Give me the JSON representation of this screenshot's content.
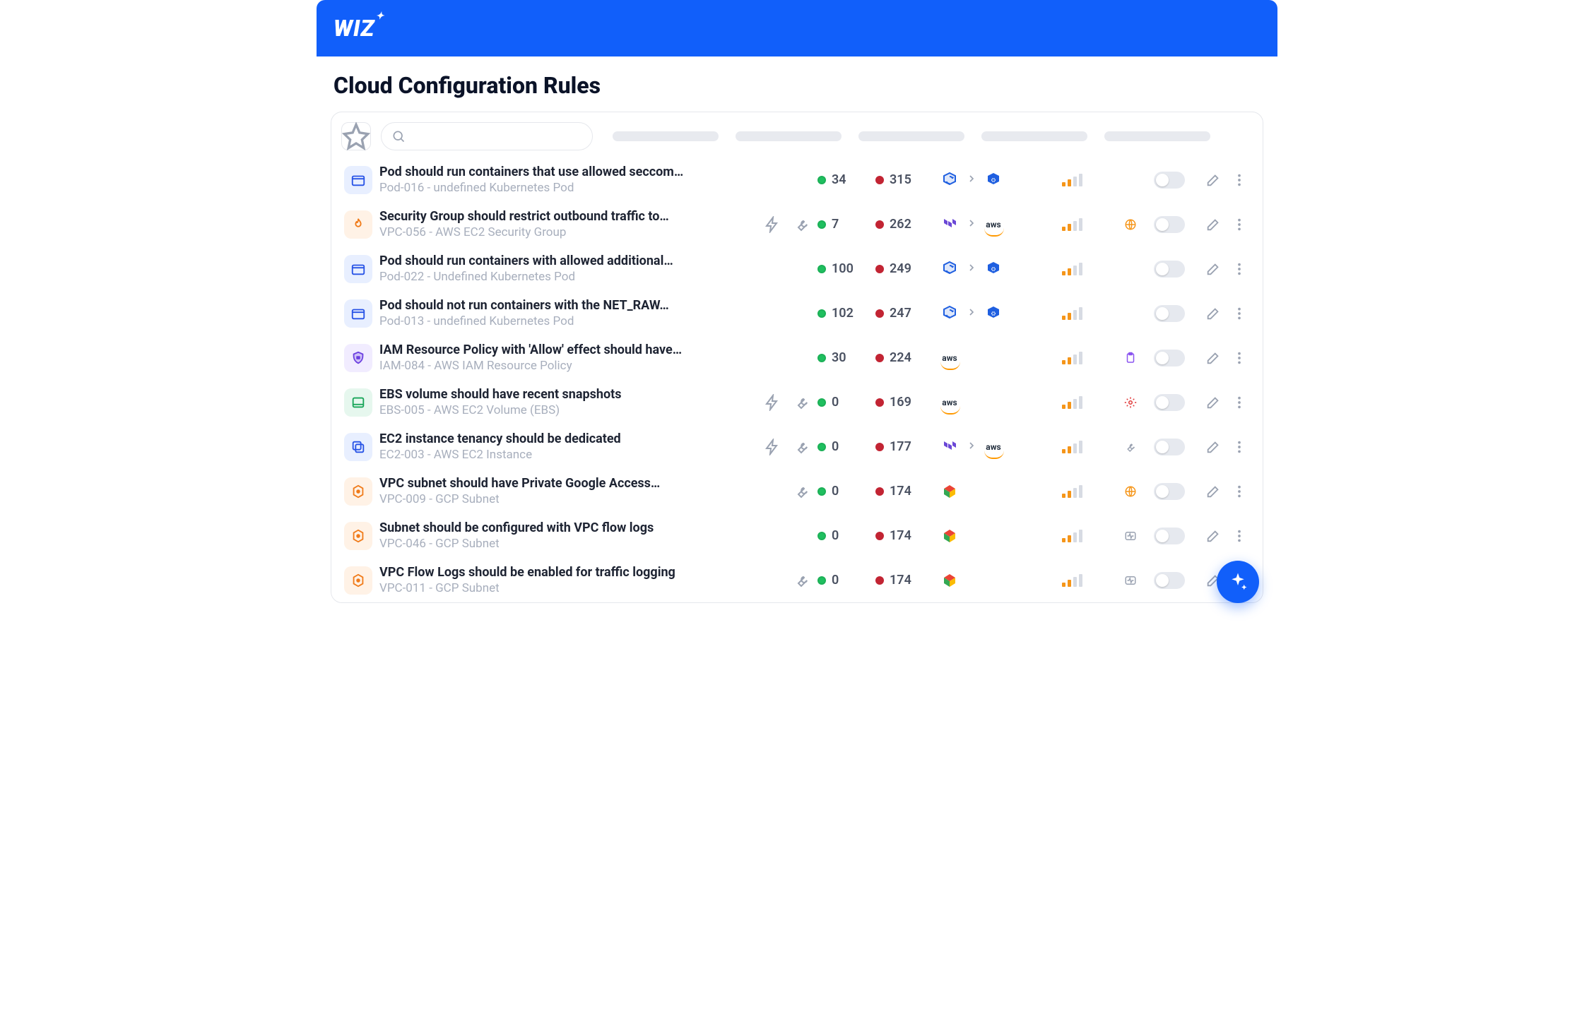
{
  "brand": "WIZ",
  "page_title": "Cloud Configuration Rules",
  "rows": [
    {
      "icon": "container",
      "icon_bg": "#e8efff",
      "icon_fg": "#2753e6",
      "title": "Pod should run containers that use allowed seccom…",
      "sub": "Pod-016 - undefined Kubernetes Pod",
      "bolt": false,
      "wrench": false,
      "pass": "34",
      "fail": "315",
      "prov": [
        "k8s-refresh",
        "chev",
        "k8s"
      ],
      "sev": [
        2,
        "#f59519"
      ],
      "badge": null
    },
    {
      "icon": "fire",
      "icon_bg": "#fff2e6",
      "icon_fg": "#f07b1a",
      "title": "Security Group should restrict outbound traffic to…",
      "sub": "VPC-056 - AWS EC2 Security Group",
      "bolt": true,
      "wrench": true,
      "pass": "7",
      "fail": "262",
      "prov": [
        "terraform",
        "chev",
        "aws"
      ],
      "sev": [
        2,
        "#f59519"
      ],
      "badge": "globe"
    },
    {
      "icon": "container",
      "icon_bg": "#e8efff",
      "icon_fg": "#2753e6",
      "title": "Pod should run containers with allowed additional…",
      "sub": "Pod-022 - Undefined Kubernetes Pod",
      "bolt": false,
      "wrench": false,
      "pass": "100",
      "fail": "249",
      "prov": [
        "k8s-refresh",
        "chev",
        "k8s"
      ],
      "sev": [
        2,
        "#f59519"
      ],
      "badge": null
    },
    {
      "icon": "container",
      "icon_bg": "#e8efff",
      "icon_fg": "#2753e6",
      "title": "Pod should not run containers with the NET_RAW…",
      "sub": "Pod-013 - undefined Kubernetes Pod",
      "bolt": false,
      "wrench": false,
      "pass": "102",
      "fail": "247",
      "prov": [
        "k8s-refresh",
        "chev",
        "k8s"
      ],
      "sev": [
        2,
        "#f59519"
      ],
      "badge": null
    },
    {
      "icon": "iam",
      "icon_bg": "#f1ecff",
      "icon_fg": "#6b3fe0",
      "title": "IAM Resource Policy with 'Allow' effect should have…",
      "sub": "IAM-084 - AWS IAM Resource Policy",
      "bolt": false,
      "wrench": false,
      "pass": "30",
      "fail": "224",
      "prov": [
        "aws"
      ],
      "sev": [
        2,
        "#f59519"
      ],
      "badge": "clipboard"
    },
    {
      "icon": "volume",
      "icon_bg": "#e6f7ee",
      "icon_fg": "#17a558",
      "title": "EBS volume should have recent snapshots",
      "sub": "EBS-005 - AWS EC2 Volume (EBS)",
      "bolt": true,
      "wrench": true,
      "pass": "0",
      "fail": "169",
      "prov": [
        "aws"
      ],
      "sev": [
        2,
        "#f59519"
      ],
      "badge": "gear-red"
    },
    {
      "icon": "copy",
      "icon_bg": "#e8efff",
      "icon_fg": "#2753e6",
      "title": "EC2 instance tenancy should be dedicated",
      "sub": "EC2-003 - AWS EC2 Instance",
      "bolt": true,
      "wrench": true,
      "pass": "0",
      "fail": "177",
      "prov": [
        "terraform",
        "chev",
        "aws"
      ],
      "sev": [
        2,
        "#f59519"
      ],
      "badge": "wrench-outline"
    },
    {
      "icon": "subnet",
      "icon_bg": "#fff2e6",
      "icon_fg": "#f07b1a",
      "title": "VPC subnet should have Private Google Access…",
      "sub": "VPC-009 - GCP Subnet",
      "bolt": false,
      "wrench": true,
      "pass": "0",
      "fail": "174",
      "prov": [
        "gcp"
      ],
      "sev": [
        2,
        "#f59519"
      ],
      "badge": "globe"
    },
    {
      "icon": "subnet",
      "icon_bg": "#fff2e6",
      "icon_fg": "#f07b1a",
      "title": "Subnet should be configured with VPC flow logs",
      "sub": "VPC-046 - GCP Subnet",
      "bolt": false,
      "wrench": false,
      "pass": "0",
      "fail": "174",
      "prov": [
        "gcp"
      ],
      "sev": [
        2,
        "#f59519"
      ],
      "badge": "pulse"
    },
    {
      "icon": "subnet",
      "icon_bg": "#fff2e6",
      "icon_fg": "#f07b1a",
      "title": "VPC Flow Logs should be enabled for traffic logging",
      "sub": "VPC-011 - GCP Subnet",
      "bolt": false,
      "wrench": true,
      "pass": "0",
      "fail": "174",
      "prov": [
        "gcp"
      ],
      "sev": [
        2,
        "#f59519"
      ],
      "badge": "pulse"
    }
  ]
}
